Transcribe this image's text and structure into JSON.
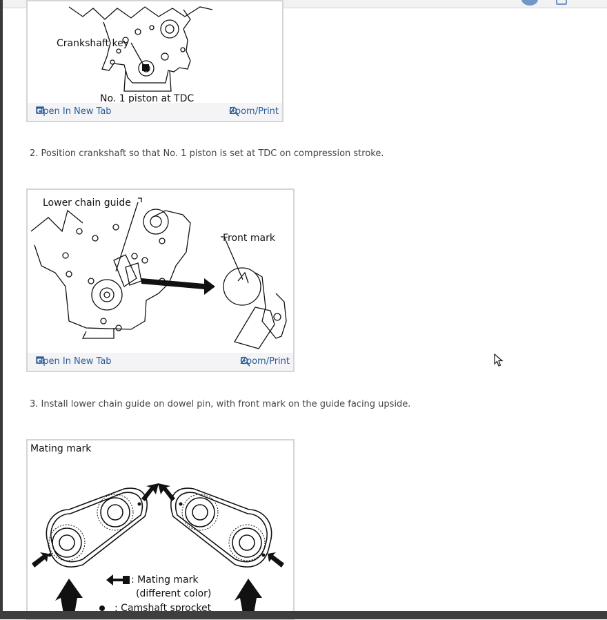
{
  "figures": [
    {
      "labels": {
        "key": "Crankshaft key",
        "tdc": "No. 1 piston at TDC"
      },
      "footer": {
        "open": "Open In New Tab",
        "zoom": "Zoom/Print"
      }
    },
    {
      "labels": {
        "guide": "Lower chain guide",
        "front": "Front mark"
      },
      "footer": {
        "open": "Open In New Tab",
        "zoom": "Zoom/Print"
      }
    },
    {
      "labels": {
        "mating": "Mating mark",
        "legend1": ": Mating mark",
        "legend2": "(different color)",
        "legend3": ": Camshaft sprocket"
      }
    }
  ],
  "steps": [
    {
      "text": "2. Position crankshaft so that No. 1 piston is set at TDC on compression stroke."
    },
    {
      "text": "3. Install lower chain guide on dowel pin, with front mark on the guide facing upside."
    }
  ],
  "colors": {
    "link": "#2a5c96",
    "frame_border": "#d5d5d5",
    "footer_bg": "#f4f4f6"
  },
  "icons": [
    "new-tab-icon",
    "zoom-icon",
    "mouse-cursor-icon"
  ]
}
